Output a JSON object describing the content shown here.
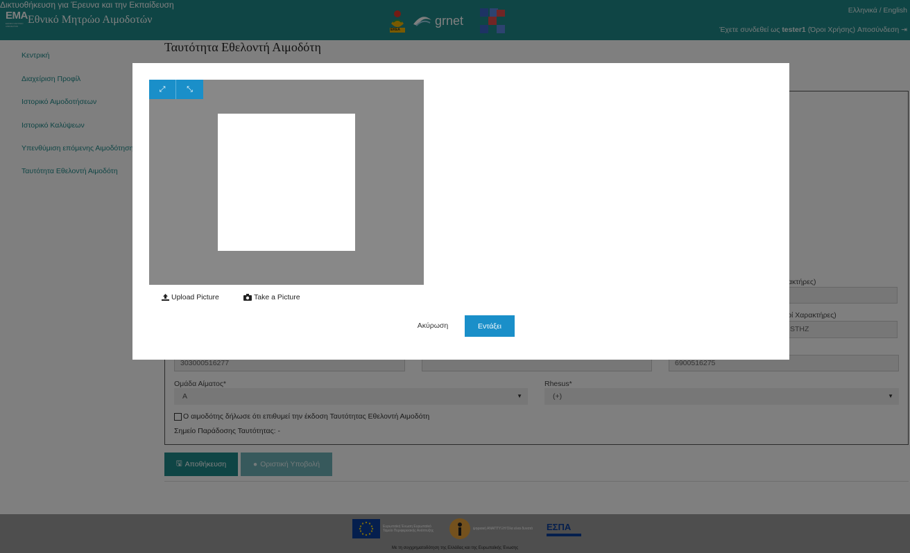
{
  "header": {
    "logo_text": "EMA",
    "logo_subtext": "ΕΘΝΙΚΟ ΜΗΤΡΩΟ ΑΙΜΟΔΟΤΩΝ",
    "site_title": "Εθνικό Μητρώο Αιμοδοτών",
    "partner_ekea_label": "ΕΚΕΑ",
    "partner_grnet_word": "grnet",
    "partner_grnet_tagline": "Δικτυοθήκευση για Έρευνα και την Εκπαίδευση",
    "language_switch": "Ελληνικά / English",
    "login_prefix": "Έχετε συνδεθεί ως",
    "username": "tester1",
    "terms_link": "(Όροι Χρήσης)",
    "logout_link": "Αποσύνδεση"
  },
  "sidebar": {
    "items": [
      {
        "label": "Κεντρική"
      },
      {
        "label": "Διαχείριση Προφίλ"
      },
      {
        "label": "Ιστορικό Αιμοδοτήσεων"
      },
      {
        "label": "Ιστορικό Καλύψεων"
      },
      {
        "label": "Υπενθύμιση επόμενης Αιμοδότησης"
      },
      {
        "label": "Ταυτότητα Εθελοντή Αιμοδότη"
      }
    ]
  },
  "main": {
    "title": "Ταυτότητα Εθελοντή Αιμοδότη",
    "label_latin_chars_1": "ρακτήρες)",
    "label_latin_chars_2": "κοί Χαρακτήρες)",
    "value_latin_name": "STHZ",
    "value_amka": "303000516277",
    "value_phone": "6900516275",
    "blood_group_label": "Ομάδα Αίματος*",
    "blood_group_value": "A",
    "rhesus_label": "Rhesus*",
    "rhesus_value": "(+)",
    "checkbox_label": "Ο αιμοδότης δήλωσε ότι επιθυμεί την έκδοση Ταυτότητας Εθελοντή Αιμοδότη",
    "pickup_label": "Σημείο Παράδοσης Ταυτότητας: -",
    "save_button": "Αποθήκευση",
    "submit_button": "Οριστική Υποβολή"
  },
  "footer": {
    "eu_text": "Ευρωπαϊκή Ένωση Ευρωπαϊκό Ταμείο Περιφερειακής Ανάπτυξης",
    "dig_text": "ψηφιακή ΑΝΑΠΤΥΞΗ Όλα είναι δυνατά",
    "espa_text": "ΕΣΠΑ",
    "caption": "Με τη συγχρηματοδότηση της Ελλάδας και της Ευρωπαϊκής Ένωσης"
  },
  "modal": {
    "expand_icon_glyph": "⤢",
    "shrink_icon_glyph": "⤡",
    "upload_link": "Upload Picture",
    "take_link": "Take a Picture",
    "cancel_button": "Ακύρωση",
    "ok_button": "Εντάξει"
  },
  "colors": {
    "header_bg": "#1e8a8a",
    "primary_button": "#1a8fc9",
    "footer_bg": "#9c9c9c"
  }
}
